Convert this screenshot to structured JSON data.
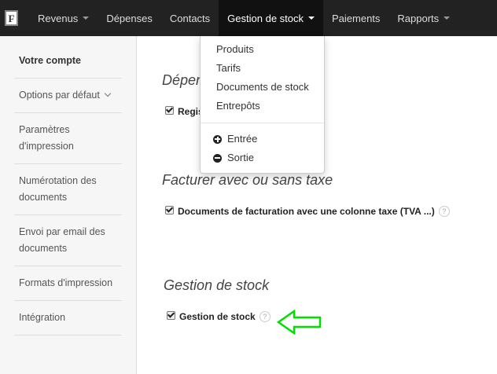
{
  "topnav": {
    "logo_letter": "F",
    "items": [
      {
        "label": "Revenus",
        "has_caret": true
      },
      {
        "label": "Dépenses",
        "has_caret": false
      },
      {
        "label": "Contacts",
        "has_caret": false
      },
      {
        "label": "Gestion de stock",
        "has_caret": true,
        "active": true
      },
      {
        "label": "Paiements",
        "has_caret": false
      },
      {
        "label": "Rapports",
        "has_caret": true
      }
    ]
  },
  "sidebar": {
    "items": [
      {
        "label": "Votre compte"
      },
      {
        "label": "Options par défaut"
      },
      {
        "label": "Paramètres d'impression"
      },
      {
        "label": "Numérotation des documents"
      },
      {
        "label": "Envoi par email des documents"
      },
      {
        "label": "Formats d'impression"
      },
      {
        "label": "Intégration"
      }
    ]
  },
  "dropdown": {
    "items": [
      "Produits",
      "Tarifs",
      "Documents de stock",
      "Entrepôts"
    ],
    "actions": [
      {
        "label": "Entrée",
        "icon": "plus-circle-icon"
      },
      {
        "label": "Sortie",
        "icon": "minus-circle-icon"
      }
    ]
  },
  "main": {
    "sections": [
      {
        "title": "Dépen",
        "checkbox_label": "Regis",
        "checked": true
      },
      {
        "title": "Facturer avec ou sans taxe",
        "checkbox_label": "Documents de facturation avec une colonne taxe (TVA ...)",
        "checked": true,
        "help": "?"
      },
      {
        "title": "Gestion de stock",
        "checkbox_label": "Gestion de stock",
        "checked": true,
        "help": "?"
      }
    ]
  },
  "annotation": {
    "arrow_color": "#00e000"
  }
}
